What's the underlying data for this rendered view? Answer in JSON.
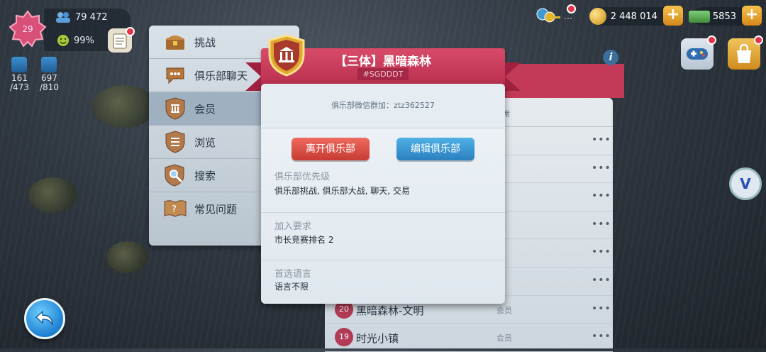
{
  "player": {
    "level": "29",
    "population": "79 472",
    "happiness": "99%"
  },
  "storage": [
    {
      "current": "161",
      "capacity": "/473"
    },
    {
      "current": "697",
      "capacity": "/810"
    }
  ],
  "resources": {
    "keys_label": "...",
    "simoleons": "2 448 014",
    "simcash": "5853"
  },
  "side_menu": [
    {
      "label": "挑战",
      "icon": "chest-icon"
    },
    {
      "label": "俱乐部聊天",
      "icon": "chat-bubble-icon"
    },
    {
      "label": "会员",
      "icon": "club-shield-icon"
    },
    {
      "label": "浏览",
      "icon": "browse-shield-icon"
    },
    {
      "label": "搜索",
      "icon": "magnifier-icon"
    },
    {
      "label": "常见问题",
      "icon": "faq-book-icon"
    }
  ],
  "background_list": {
    "header": "席",
    "rows": [
      {
        "rank": "",
        "name": "",
        "role": "员"
      },
      {
        "rank": "",
        "name": "",
        "role": "员"
      },
      {
        "rank": "",
        "name": "",
        "role": "员"
      },
      {
        "rank": "",
        "name": "",
        "role": "员"
      },
      {
        "rank": "",
        "name": "",
        "role": "员"
      },
      {
        "rank": "",
        "name": "",
        "role": "员"
      },
      {
        "rank": "20",
        "name": "黑暗森林-文明",
        "role": "会员"
      },
      {
        "rank": "19",
        "name": "时光小镇",
        "role": "会员"
      }
    ],
    "dots": "•••"
  },
  "dialog": {
    "title": "【三体】黑暗森林",
    "tag": "#SGDDDT",
    "wechat": "俱乐部微信群加：ztz362527",
    "leave_button": "离开俱乐部",
    "edit_button": "编辑俱乐部",
    "priority_heading": "俱乐部优先级",
    "priority_value": "俱乐部挑战, 俱乐部大战, 聊天, 交易",
    "join_heading": "加入要求",
    "join_value": "市长竞赛排名 2",
    "language_heading": "首选语言",
    "language_value": "语言不限"
  },
  "colors": {
    "ribbon": "#c23a57",
    "leave": "#d9473e",
    "edit": "#3a95d3"
  }
}
